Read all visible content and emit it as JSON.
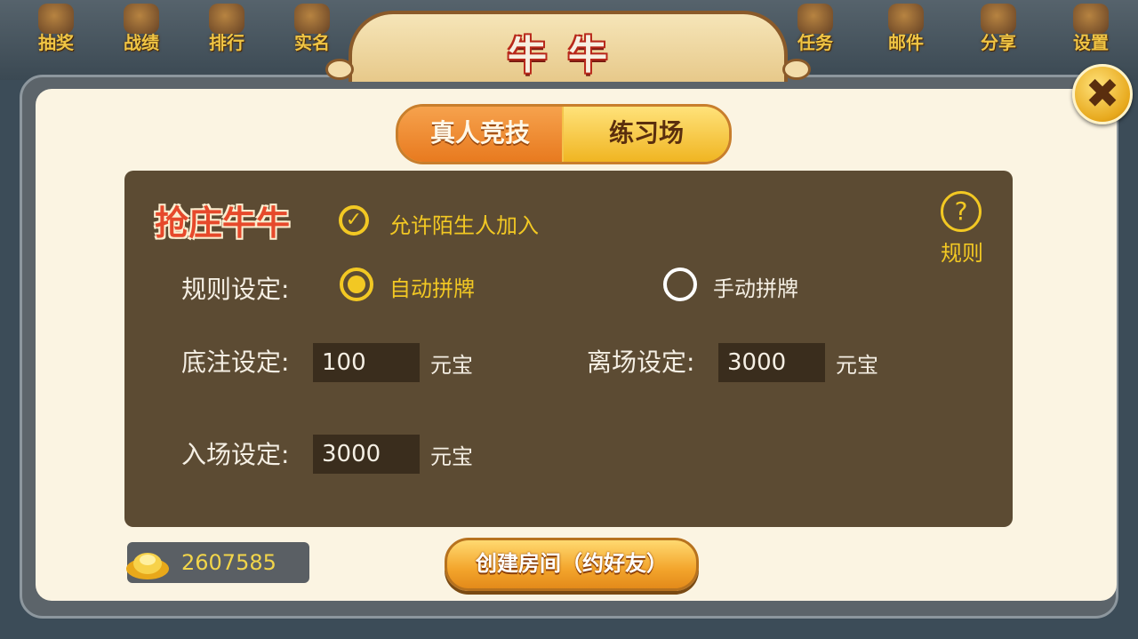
{
  "nav": {
    "left": [
      {
        "label": "抽奖",
        "icon": "lottery-icon"
      },
      {
        "label": "战绩",
        "icon": "record-icon"
      },
      {
        "label": "排行",
        "icon": "rank-icon"
      },
      {
        "label": "实名",
        "icon": "realname-icon"
      }
    ],
    "right": [
      {
        "label": "任务",
        "icon": "task-icon"
      },
      {
        "label": "邮件",
        "icon": "mail-icon"
      },
      {
        "label": "分享",
        "icon": "share-icon"
      },
      {
        "label": "设置",
        "icon": "settings-icon"
      }
    ]
  },
  "title": "牛牛",
  "tabs": {
    "real": "真人竞技",
    "practice": "练习场",
    "active": "real"
  },
  "room": {
    "mode_title": "抢庄牛牛",
    "allow_strangers": {
      "label": "允许陌生人加入",
      "checked": true
    },
    "help_label": "规则",
    "rule_setting": {
      "label": "规则设定:",
      "options": [
        "自动拼牌",
        "手动拼牌"
      ],
      "selected": "自动拼牌"
    },
    "base_bet": {
      "label": "底注设定:",
      "value": "100",
      "unit": "元宝"
    },
    "leave": {
      "label": "离场设定:",
      "value": "3000",
      "unit": "元宝"
    },
    "entry": {
      "label": "入场设定:",
      "value": "3000",
      "unit": "元宝"
    }
  },
  "gold": "2607585",
  "create_button": "创建房间（约好友）",
  "colors": {
    "accent_yellow": "#f2c823",
    "panel_brown": "#5c4b33",
    "title_red": "#e6492b"
  }
}
